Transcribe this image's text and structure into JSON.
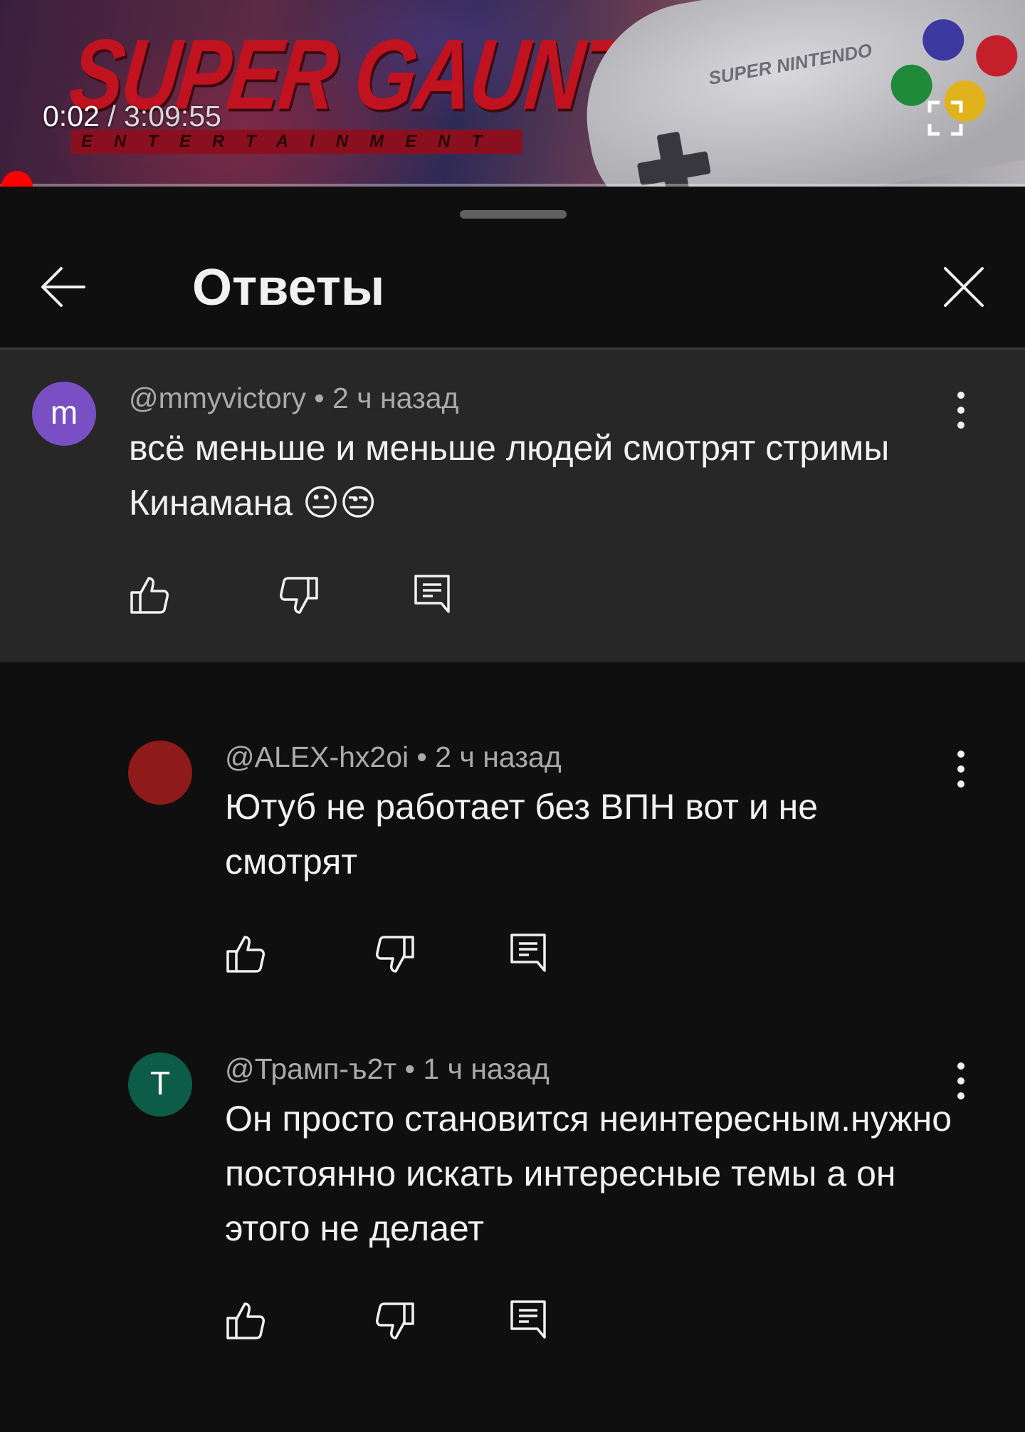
{
  "player": {
    "current_time": "0:02",
    "separator": " / ",
    "duration": "3:09:55",
    "progress_fraction": 0.0002,
    "thumbnail": {
      "title_art": "SUPER GAUNTLET",
      "subtitle_art": "ENTERTAINMENT SYSTEM",
      "controller_logo": "SUPER NINTENDO"
    }
  },
  "sheet": {
    "title": "Ответы",
    "back_icon": "arrow-left-icon",
    "close_icon": "close-icon"
  },
  "parent_comment": {
    "avatar_letter": "m",
    "avatar_color": "#7b4fc4",
    "author": "@mmyvictory",
    "time": "2 ч назад",
    "text": "всё меньше и меньше людей смотрят стримы Кинамана 😐😒"
  },
  "replies": [
    {
      "avatar_letter": "",
      "avatar_color": "#8e1a1a",
      "author": "@ALEX-hx2oi",
      "time": "2 ч назад",
      "text": "Ютуб не работает без ВПН вот и не смотрят"
    },
    {
      "avatar_letter": "T",
      "avatar_color": "#0d5c47",
      "author": "@Трамп-ъ2т",
      "time": "1 ч назад",
      "text": "Он просто становится неинтересным.нужно постоянно искать интересные темы а он этого не делает"
    }
  ],
  "colors": {
    "background": "#0f0f0f",
    "highlight_background": "#272727",
    "accent": "#ff0000",
    "meta_text": "#aaaaaa"
  },
  "icons": {
    "like": "thumbs-up-icon",
    "dislike": "thumbs-down-icon",
    "reply": "reply-comment-icon",
    "more": "more-vertical-icon",
    "fullscreen": "fullscreen-icon"
  }
}
